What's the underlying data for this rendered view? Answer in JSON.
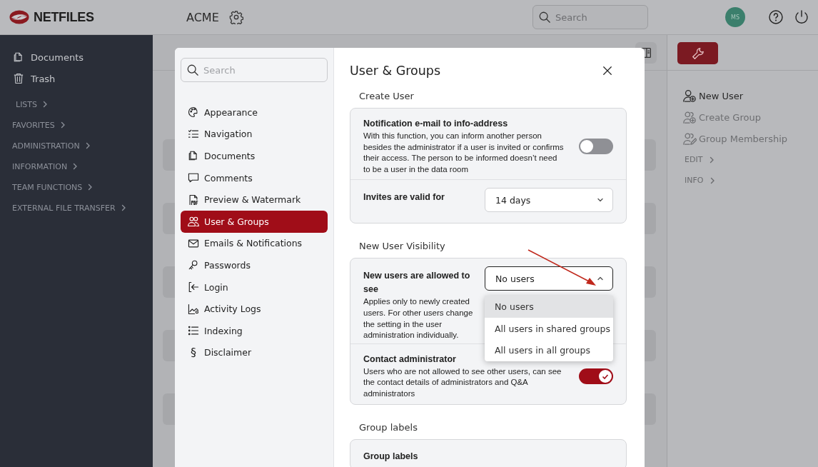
{
  "header": {
    "logo": "NETFILES",
    "workspace": "ACME",
    "search": {
      "placeholder": "Search"
    },
    "avatar": "MS"
  },
  "sidebar": {
    "items": [
      {
        "label": "Documents"
      },
      {
        "label": "Trash"
      }
    ],
    "sections": [
      {
        "label": "LISTS"
      },
      {
        "label": "FAVORITES"
      },
      {
        "label": "ADMINISTRATION"
      },
      {
        "label": "INFORMATION"
      },
      {
        "label": "TEAM FUNCTIONS"
      },
      {
        "label": "EXTERNAL FILE TRANSFER"
      }
    ]
  },
  "right_panel": {
    "actions": [
      {
        "label": "New User",
        "disabled": false
      },
      {
        "label": "Create Group",
        "disabled": true
      },
      {
        "label": "Group Membership",
        "disabled": true
      }
    ],
    "sections": [
      {
        "label": "EDIT"
      },
      {
        "label": "INFO"
      }
    ]
  },
  "dialog": {
    "title": "User & Groups",
    "search": {
      "placeholder": "Search"
    },
    "nav": [
      {
        "label": "Appearance",
        "selected": false
      },
      {
        "label": "Navigation",
        "selected": false
      },
      {
        "label": "Documents",
        "selected": false
      },
      {
        "label": "Comments",
        "selected": false
      },
      {
        "label": "Preview & Watermark",
        "selected": false
      },
      {
        "label": "User & Groups",
        "selected": true
      },
      {
        "label": "Emails & Notifications",
        "selected": false
      },
      {
        "label": "Passwords",
        "selected": false
      },
      {
        "label": "Login",
        "selected": false
      },
      {
        "label": "Activity Logs",
        "selected": false
      },
      {
        "label": "Indexing",
        "selected": false
      },
      {
        "label": "Disclaimer",
        "icon_text": "§",
        "selected": false
      }
    ],
    "sections": [
      {
        "heading": "Create User",
        "rows": [
          {
            "kind": "toggle",
            "label": "Notification e-mail to info-address",
            "description": "With this function, you can inform another person besides the administrator if a user is invited or confirms their access. The person to be informed doesn’t need to be a user in the data room",
            "on": false
          },
          {
            "kind": "select",
            "label": "Invites are valid for",
            "value": "14 days",
            "expanded": false
          }
        ]
      },
      {
        "heading": "New User Visibility",
        "rows": [
          {
            "kind": "select",
            "label": "New users are allowed to see",
            "description": "Applies only to newly created users. For other users change the setting in the user administration individually.",
            "value": "No users",
            "expanded": true,
            "options": [
              {
                "label": "No users",
                "selected": true
              },
              {
                "label": "All users in shared groups",
                "selected": false
              },
              {
                "label": "All users in all groups",
                "selected": false
              }
            ]
          },
          {
            "kind": "toggle",
            "label": "Contact administrator",
            "description": "Users who are not allowed to see other users, can see the contact details of administrators and Q&A administrators",
            "on": true
          }
        ]
      },
      {
        "heading": "Group labels",
        "rows": [
          {
            "kind": "text",
            "label": "Group labels"
          }
        ]
      }
    ]
  }
}
